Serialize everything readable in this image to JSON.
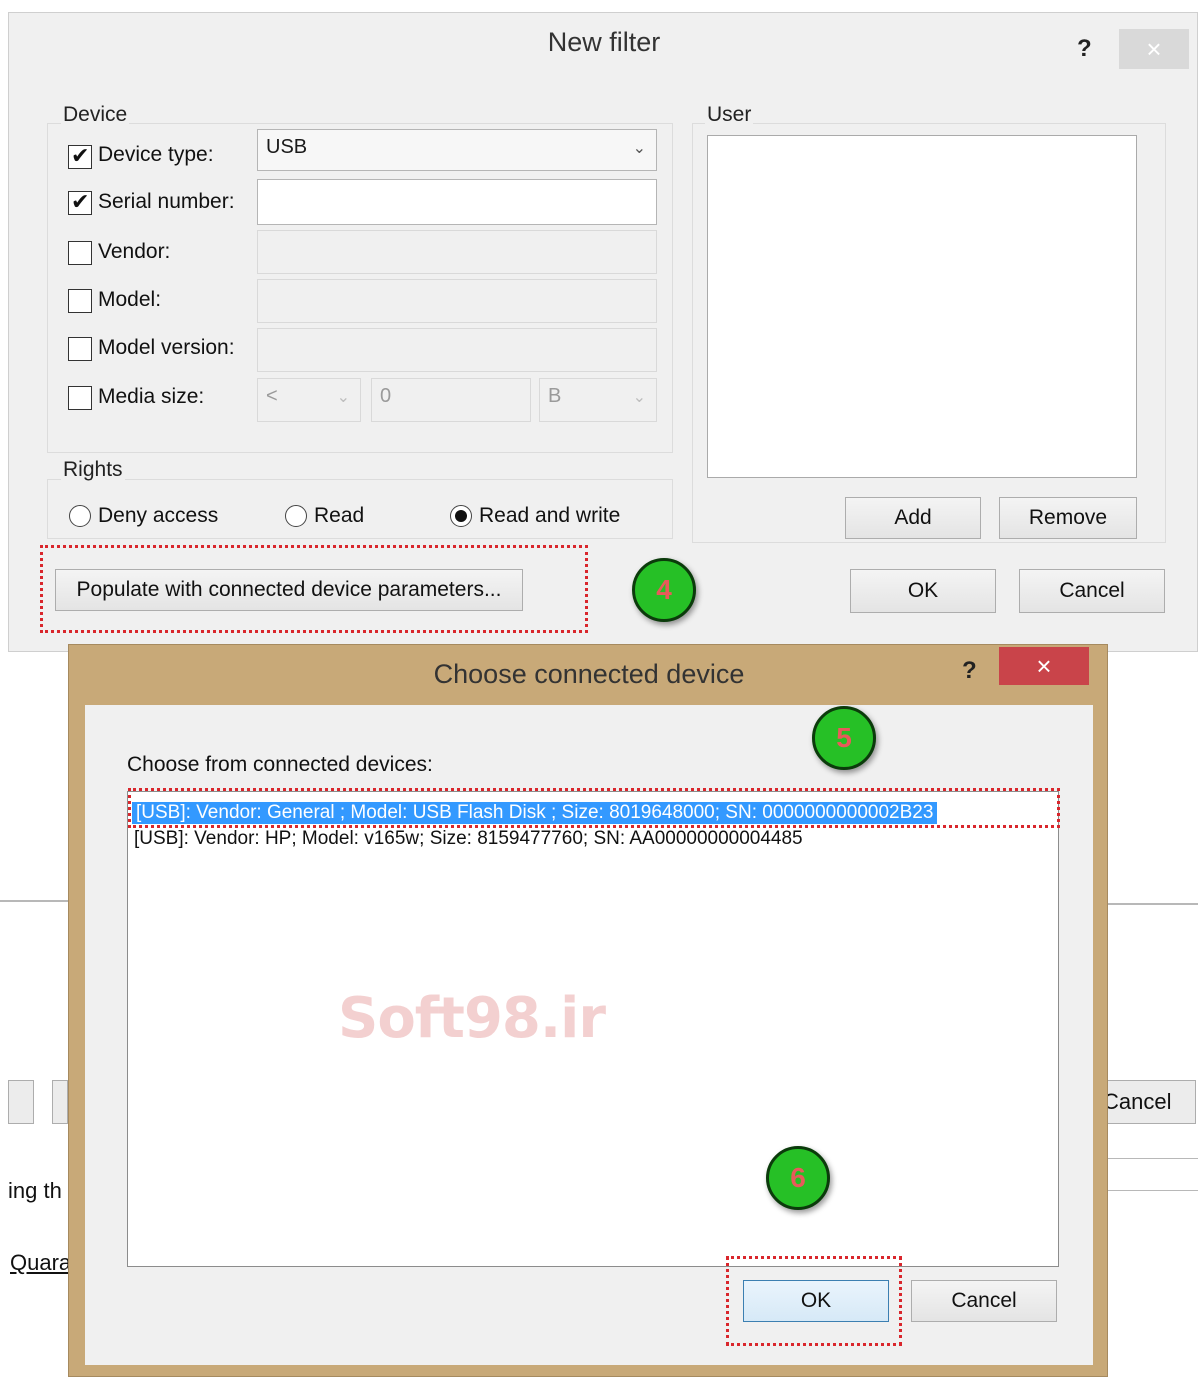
{
  "background": {
    "cancel_label": "Cancel",
    "partial_text": "ing th",
    "quarantine_link": "Quara"
  },
  "new_filter": {
    "title": "New filter",
    "help": "?",
    "close": "×",
    "device_group": "Device",
    "device_type": {
      "label": "Device type:",
      "checked": true,
      "value": "USB"
    },
    "serial_number": {
      "label": "Serial number:",
      "checked": true,
      "value": ""
    },
    "vendor": {
      "label": "Vendor:",
      "checked": false,
      "value": ""
    },
    "model": {
      "label": "Model:",
      "checked": false,
      "value": ""
    },
    "model_version": {
      "label": "Model version:",
      "checked": false,
      "value": ""
    },
    "media_size": {
      "label": "Media size:",
      "checked": false,
      "operator": "<",
      "value": "0",
      "unit": "B"
    },
    "rights_group": "Rights",
    "rights": [
      {
        "label": "Deny access",
        "selected": false
      },
      {
        "label": "Read",
        "selected": false
      },
      {
        "label": "Read and write",
        "selected": true
      }
    ],
    "user_group": "User",
    "add_label": "Add",
    "remove_label": "Remove",
    "populate_label": "Populate with connected device parameters...",
    "ok_label": "OK",
    "cancel_label": "Cancel"
  },
  "choose_dialog": {
    "title": "Choose connected device",
    "help": "?",
    "close": "×",
    "prompt": "Choose from connected devices:",
    "devices": [
      {
        "text": "[USB]: Vendor: General ; Model: USB Flash Disk  ; Size: 8019648000; SN: 0000000000002B23",
        "selected": true
      },
      {
        "text": "[USB]: Vendor: HP; Model: v165w; Size: 8159477760; SN: AA00000000004485",
        "selected": false
      }
    ],
    "watermark": "Soft98.ir",
    "ok_label": "OK",
    "cancel_label": "Cancel"
  },
  "steps": [
    "4",
    "5",
    "6"
  ],
  "colors": {
    "annotation_red": "#d9262c",
    "badge_green": "#26c026",
    "selection_blue": "#3399ff",
    "close_red": "#c9444a"
  }
}
